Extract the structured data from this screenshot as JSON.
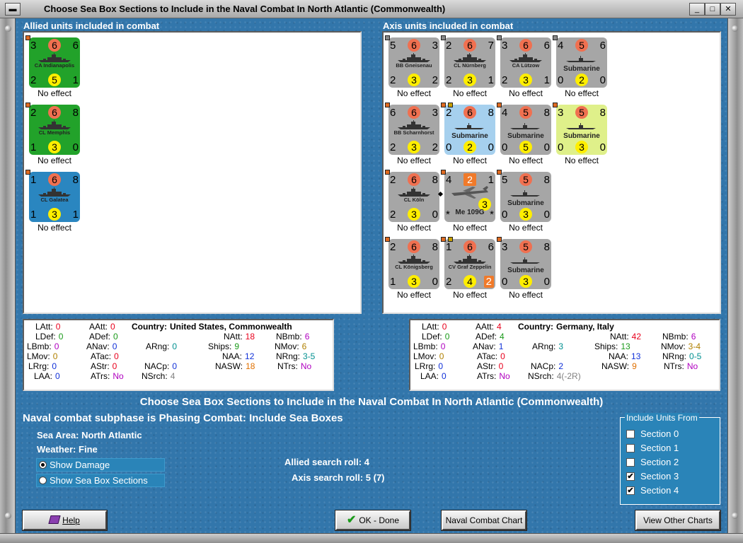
{
  "window": {
    "title": "Choose Sea Box Sections to Include in the Naval Combat In North Atlantic (Commonwealth)",
    "btn_min": "_",
    "btn_max": "□",
    "btn_close": "✕",
    "btn_sys": "▬"
  },
  "allied": {
    "title": "Allied units included in combat",
    "units": [
      {
        "tl": "3",
        "tc": "6",
        "tr": "6",
        "bl": "2",
        "bc": "5",
        "br": "1",
        "name": "CA Indianapolis",
        "effect": "No effect"
      },
      {
        "tl": "2",
        "tc": "6",
        "tr": "8",
        "bl": "1",
        "bc": "3",
        "br": "0",
        "name": "CL Memphis",
        "effect": "No effect"
      },
      {
        "tl": "1",
        "tc": "6",
        "tr": "8",
        "bl": "1",
        "bc": "3",
        "br": "1",
        "name": "CL Galatea",
        "effect": "No effect"
      }
    ]
  },
  "axis": {
    "title": "Axis units included in combat",
    "units": [
      {
        "tl": "5",
        "tc": "6",
        "tr": "3",
        "bl": "2",
        "bc": "3",
        "br": "2",
        "name": "BB Gneisenau",
        "effect": "No effect"
      },
      {
        "tl": "2",
        "tc": "6",
        "tr": "7",
        "bl": "2",
        "bc": "3",
        "br": "1",
        "name": "CL Nürnberg",
        "effect": "No effect"
      },
      {
        "tl": "3",
        "tc": "6",
        "tr": "6",
        "bl": "2",
        "bc": "3",
        "br": "1",
        "name": "CA Lützow",
        "effect": "No effect"
      },
      {
        "tl": "4",
        "tc": "5",
        "tr": "6",
        "bl": "0",
        "bc": "2",
        "br": "0",
        "name": "Submarine",
        "effect": "No effect"
      },
      {
        "tl": "6",
        "tc": "6",
        "tr": "3",
        "bl": "2",
        "bc": "3",
        "br": "2",
        "name": "BB Scharnhorst",
        "effect": "No effect"
      },
      {
        "tl": "2",
        "tc": "6",
        "tr": "8",
        "bl": "0",
        "bc": "2",
        "br": "0",
        "name": "Submarine",
        "effect": "No effect"
      },
      {
        "tl": "4",
        "tc": "5",
        "tr": "8",
        "bl": "0",
        "bc": "5",
        "br": "0",
        "name": "Submarine",
        "effect": "No effect"
      },
      {
        "tl": "3",
        "tc": "5",
        "tr": "8",
        "bl": "0",
        "bc": "3",
        "br": "0",
        "name": "Submarine",
        "effect": "No effect"
      },
      {
        "tl": "2",
        "tc": "6",
        "tr": "8",
        "bl": "2",
        "bc": "3",
        "br": "0",
        "name": "CL Köln",
        "effect": "No effect"
      },
      {
        "tl": "4",
        "tc": "2",
        "tr": "1",
        "bl": "*",
        "bc": "3",
        "br": "*",
        "name": "Me 109G",
        "effect": "No effect"
      },
      {
        "tl": "5",
        "tc": "5",
        "tr": "8",
        "bl": "0",
        "bc": "3",
        "br": "0",
        "name": "Submarine",
        "effect": "No effect"
      },
      {
        "tl": "2",
        "tc": "6",
        "tr": "8",
        "bl": "1",
        "bc": "3",
        "br": "0",
        "name": "CL Königsberg",
        "effect": "No effect"
      },
      {
        "tl": "1",
        "tc": "6",
        "tr": "6",
        "bl": "2",
        "bc": "4",
        "br": "2",
        "name": "CV Graf Zeppelin",
        "effect": "No effect"
      },
      {
        "tl": "3",
        "tc": "5",
        "tr": "8",
        "bl": "0",
        "bc": "3",
        "br": "0",
        "name": "Submarine",
        "effect": "No effect"
      }
    ]
  },
  "allied_stats": {
    "latt_l": "LAtt:",
    "latt": "0",
    "ldef_l": "LDef:",
    "ldef": "0",
    "lbmb_l": "LBmb:",
    "lbmb": "0",
    "lmov_l": "LMov:",
    "lmov": "0",
    "lrng_l": "LRrg:",
    "lrng": "0",
    "laa_l": "LAA:",
    "laa": "0",
    "aatt_l": "AAtt:",
    "aatt": "0",
    "adef_l": "ADef:",
    "adef": "0",
    "anav_l": "ANav:",
    "anav": "0",
    "atac_l": "ATac:",
    "atac": "0",
    "astr_l": "AStr:",
    "astr": "0",
    "atrs_l": "ATrs:",
    "atrs": "No",
    "country_l": "Country:",
    "country": "United States, Commonwealth",
    "arng_l": "ARng:",
    "arng": "0",
    "nacp_l": "NACp:",
    "nacp": "0",
    "nsrch_l": "NSrch:",
    "nsrch": "4",
    "natt_l": "NAtt:",
    "natt": "18",
    "ships_l": "Ships:",
    "ships": "9",
    "naa_l": "NAA:",
    "naa": "12",
    "nasw_l": "NASW:",
    "nasw": "18",
    "nbmb_l": "NBmb:",
    "nbmb": "6",
    "nmov_l": "NMov:",
    "nmov": "6",
    "nrng_l": "NRng:",
    "nrng": "3-5",
    "ntrs_l": "NTrs:",
    "ntrs": "No"
  },
  "axis_stats": {
    "latt_l": "LAtt:",
    "latt": "0",
    "ldef_l": "LDef:",
    "ldef": "0",
    "lbmb_l": "LBmb:",
    "lbmb": "0",
    "lmov_l": "LMov:",
    "lmov": "0",
    "lrng_l": "LRrg:",
    "lrng": "0",
    "laa_l": "LAA:",
    "laa": "0",
    "aatt_l": "AAtt:",
    "aatt": "4",
    "adef_l": "ADef:",
    "adef": "4",
    "anav_l": "ANav:",
    "anav": "1",
    "atac_l": "ATac:",
    "atac": "0",
    "astr_l": "AStr:",
    "astr": "0",
    "atrs_l": "ATrs:",
    "atrs": "No",
    "country_l": "Country:",
    "country": "Germany, Italy",
    "arng_l": "ARng:",
    "arng": "3",
    "nacp_l": "NACp:",
    "nacp": "2",
    "nsrch_l": "NSrch:",
    "nsrch": "4(-2R)",
    "natt_l": "NAtt:",
    "natt": "42",
    "ships_l": "Ships:",
    "ships": "13",
    "naa_l": "NAA:",
    "naa": "13",
    "nasw_l": "NASW:",
    "nasw": "9",
    "nbmb_l": "NBmb:",
    "nbmb": "6",
    "nmov_l": "NMov:",
    "nmov": "3-4",
    "nrng_l": "NRng:",
    "nrng": "0-5",
    "ntrs_l": "NTrs:",
    "ntrs": "No"
  },
  "main": {
    "heading": "Choose Sea Box Sections to Include in the Naval Combat In North Atlantic (Commonwealth)",
    "subphase": "Naval combat subphase is Phasing Combat: Include Sea Boxes",
    "sea_area_l": "Sea Area:",
    "sea_area": "North Atlantic",
    "weather_l": "Weather:",
    "weather": "Fine",
    "show_damage": "Show Damage",
    "show_sections": "Show Sea Box Sections",
    "allied_roll_l": "Allied search roll:",
    "allied_roll": "4",
    "axis_roll_l": "Axis search roll:",
    "axis_roll": "5 (7)"
  },
  "include": {
    "legend": "Include Units From",
    "sections": [
      {
        "label": "Section 0",
        "checked": false
      },
      {
        "label": "Section 1",
        "checked": false
      },
      {
        "label": "Section 2",
        "checked": false
      },
      {
        "label": "Section 3",
        "checked": true
      },
      {
        "label": "Section 4",
        "checked": true
      }
    ]
  },
  "buttons": {
    "help": "Help",
    "ok": "OK - Done",
    "naval_chart": "Naval Combat Chart",
    "other_charts": "View Other Charts"
  },
  "colors": {
    "allied_green": "#22a22a",
    "allied_blue": "#2a86c0",
    "axis_gray": "#a6a6a6",
    "sub_blue": "#a6d0ee",
    "sub_yellow": "#dff08a",
    "red_val": "#e8001c",
    "green_val": "#1a9a1a",
    "purple_val": "#b000c0",
    "blue_val": "#1030d8",
    "orange_val": "#e07000",
    "teal_val": "#009090",
    "gray_val": "#808080"
  }
}
